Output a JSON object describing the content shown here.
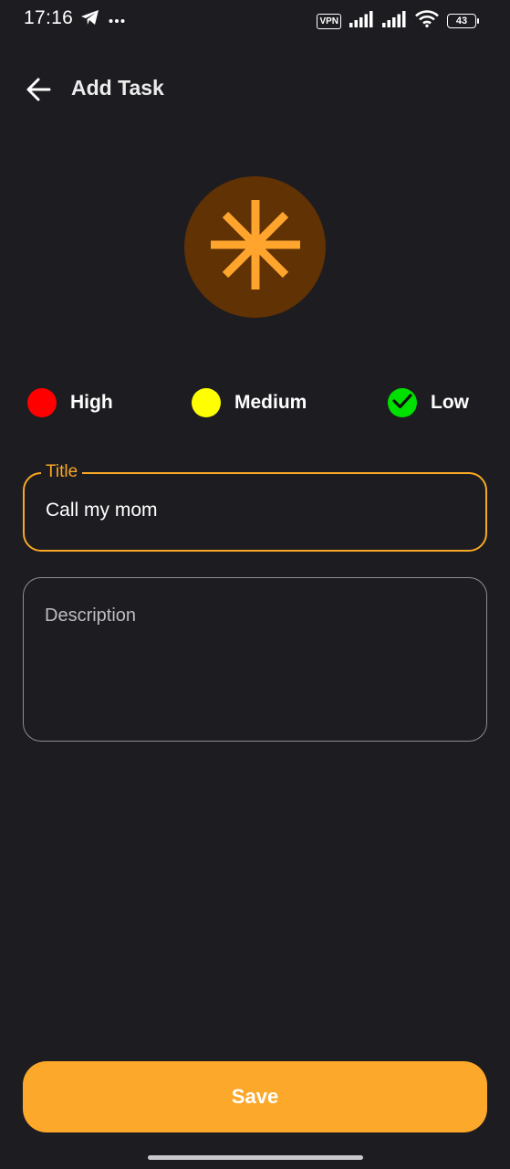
{
  "status_bar": {
    "time": "17:16",
    "vpn_label": "VPN",
    "battery_level": "43",
    "icons": [
      "telegram-icon",
      "more-icon",
      "signal-icon",
      "signal-icon",
      "wifi-icon",
      "battery-icon"
    ]
  },
  "app_bar": {
    "title": "Add Task",
    "back_icon": "arrow-back-icon"
  },
  "task_icon": {
    "icon": "snowflake-icon",
    "color": "#ffa42c",
    "background": "#603204"
  },
  "priorities": [
    {
      "label": "High",
      "color": "#ff0000",
      "selected": false
    },
    {
      "label": "Medium",
      "color": "#ffff00",
      "selected": false
    },
    {
      "label": "Low",
      "color": "#00e000",
      "selected": true
    }
  ],
  "form": {
    "title_label": "Title",
    "title_value": "Call my mom",
    "description_placeholder": "Description"
  },
  "actions": {
    "save_label": "Save"
  },
  "colors": {
    "background": "#1d1c21",
    "accent": "#f9a825",
    "button": "#fca82a"
  }
}
